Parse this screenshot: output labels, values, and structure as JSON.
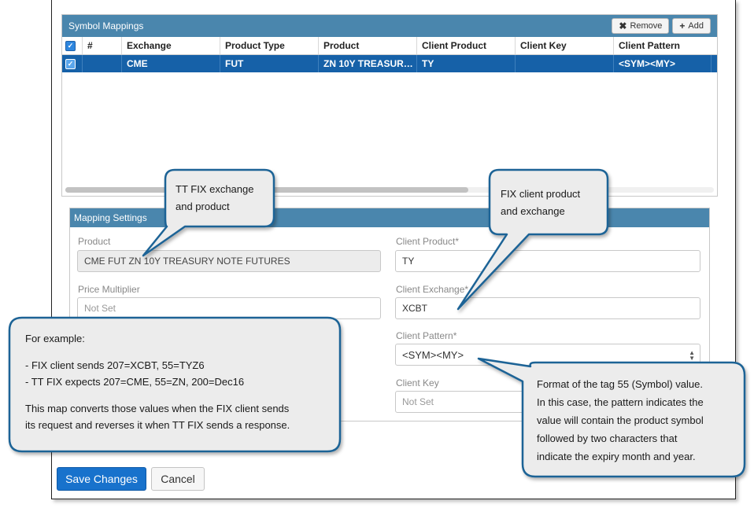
{
  "symbol_mappings": {
    "title": "Symbol Mappings",
    "remove_label": "Remove",
    "add_label": "Add",
    "columns": [
      "#",
      "Exchange",
      "Product Type",
      "Product",
      "Client Product",
      "Client Key",
      "Client Pattern"
    ],
    "rows": [
      {
        "num": "",
        "exchange": "CME",
        "product_type": "FUT",
        "product": "ZN 10Y TREASUR…",
        "client_product": "TY",
        "client_key": "",
        "client_pattern": "<SYM><MY>",
        "selected": true
      }
    ]
  },
  "mapping_settings": {
    "title": "Mapping Settings",
    "product_label": "Product",
    "product_value": "CME FUT ZN 10Y TREASURY NOTE FUTURES",
    "price_multiplier_label": "Price Multiplier",
    "price_multiplier_placeholder": "Not Set",
    "client_product_label": "Client Product*",
    "client_product_value": "TY",
    "client_exchange_label": "Client Exchange*",
    "client_exchange_value": "XCBT",
    "client_pattern_label": "Client Pattern*",
    "client_pattern_value": "<SYM><MY>",
    "client_key_label": "Client Key",
    "client_key_placeholder": "Not Set"
  },
  "actions": {
    "save_label": "Save Changes",
    "cancel_label": "Cancel"
  },
  "callouts": {
    "tt_fix": [
      "TT FIX exchange",
      "and product"
    ],
    "fix_client": [
      "FIX client product",
      "and exchange"
    ],
    "example": {
      "heading": "For example:",
      "line1": "- FIX client sends 207=XCBT, 55=TYZ6",
      "line2": "- TT FIX expects 207=CME, 55=ZN, 200=Dec16",
      "line3": "This map converts those values when the FIX client sends",
      "line4": "its request and reverses it when TT FIX sends a response."
    },
    "pattern": [
      "Format of the tag 55 (Symbol) value.",
      "In this case, the pattern indicates the",
      "value will contain the product symbol",
      "followed by two characters that",
      "indicate the expiry month and year."
    ]
  },
  "colors": {
    "panel_header": "#4a86ad",
    "selected_row": "#1661a8",
    "primary_button": "#1872cc",
    "callout_border": "#1f6496",
    "callout_fill": "#ececec"
  }
}
